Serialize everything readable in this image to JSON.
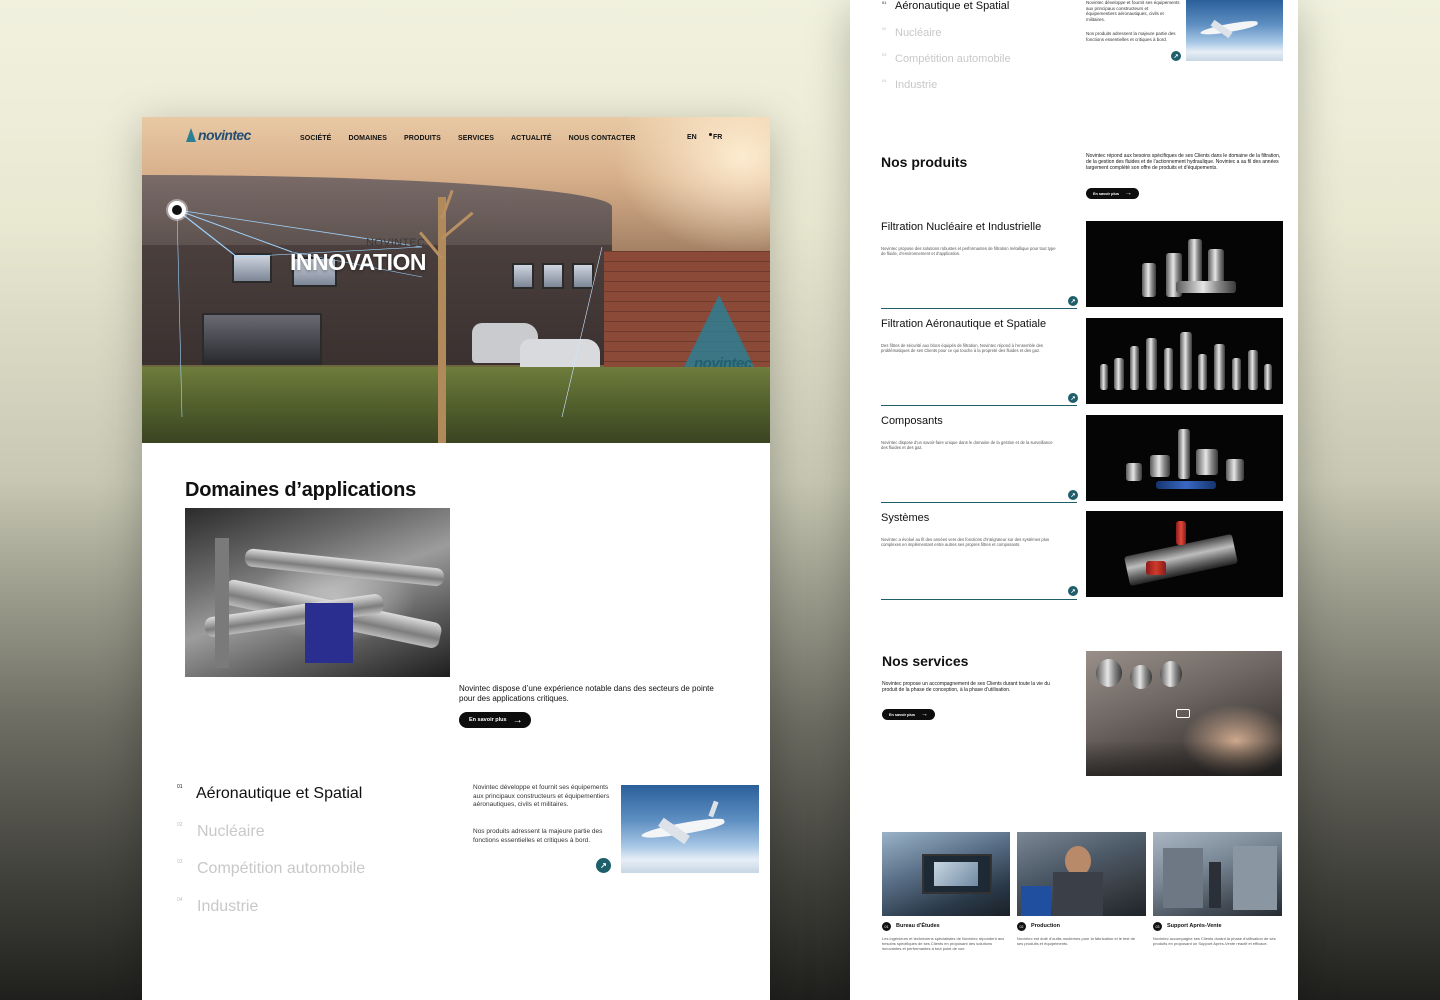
{
  "left_page": {
    "nav": {
      "logo": "novintec",
      "links": [
        "SOCIÉTÉ",
        "DOMAINES",
        "PRODUITS",
        "SERVICES",
        "ACTUALITÉ",
        "NOUS CONTACTER"
      ],
      "lang_en": "EN",
      "lang_fr": "FR"
    },
    "hero": {
      "brand_small": "NOVINTEC",
      "brand_big": "INNOVATION",
      "wall_sign": "novintec"
    },
    "domaines": {
      "title": "Domaines d’applications",
      "description": "Novintec dispose d’une expérience notable dans des secteurs de pointe pour des applications critiques.",
      "button": "En savoir plus"
    },
    "applications": [
      {
        "num": "01",
        "label": "Aéronautique et Spatial"
      },
      {
        "num": "02",
        "label": "Nucléaire"
      },
      {
        "num": "03",
        "label": "Compétition automobile"
      },
      {
        "num": "04",
        "label": "Industrie"
      }
    ],
    "app_desc_1": "Novintec développe et fournit ses équipements aux principaux constructeurs et équipementiers aéronautiques, civils et militaires.",
    "app_desc_2": "Nos produits adressent la majeure partie des fonctions essentielles et critiques à bord."
  },
  "right_page": {
    "applications": [
      {
        "num": "01",
        "label": "Aéronautique et Spatial"
      },
      {
        "num": "02",
        "label": "Nucléaire"
      },
      {
        "num": "03",
        "label": "Compétition automobile"
      },
      {
        "num": "04",
        "label": "Industrie"
      }
    ],
    "app_desc_1": "Novintec développe et fournit ses équipements aux principaux constructeurs et équipementiers aéronautiques, civils et militaires.",
    "app_desc_2": "Nos produits adressent la majeure partie des fonctions essentielles et critiques à bord.",
    "produits": {
      "title": "Nos produits",
      "intro": "Novintec répond aux besoins spécifiques de ses Clients dans le domaine de la filtration, de la gestion des fluides et de l’actionnement hydraulique. Novintec a au fil des années largement complété son offre de produits et d’équipements.",
      "button": "En savoir plus",
      "items": [
        {
          "title": "Filtration Nucléaire et Industrielle",
          "desc": "Novintec propose des solutions robustes et performantes de filtration métallique pour tout type de fluide, d’environnement et d’application."
        },
        {
          "title": "Filtration Aéronautique et Spatiale",
          "desc": "Des filtres de sécurité aux blocs équipés de filtration, Novintec répond à l’ensemble des problématiques de ses Clients pour ce qui touche à la propreté des fluides et des gaz."
        },
        {
          "title": "Composants",
          "desc": "Novintec dispose d’un savoir-faire unique dans le domaine de la gestion et de la surveillance des fluides et des gaz."
        },
        {
          "title": "Systèmes",
          "desc": "Novintec a évolué au fil des années vers des fonctions d’intégrateur sur des systèmes plus complexes en implémentant entre autres ses propres filtres et composants."
        }
      ]
    },
    "services": {
      "title": "Nos services",
      "intro": "Novintec propose un accompagnement de ses Clients durant toute la vie du produit de la phase de conception, à la phase d’utilisation.",
      "button": "En savoir plus",
      "cards": [
        {
          "num": "01",
          "title": "Bureau d’Études",
          "desc": "Les ingénieurs et techniciens spécialistes de Novintec répondent aux besoins spécifiques de ses Clients en proposant des solutions innovantes et performantes à tout point de vue."
        },
        {
          "num": "02",
          "title": "Production",
          "desc": "Novintec est doté d’outils modernes pour la fabrication et le test de ses produits et équipements."
        },
        {
          "num": "03",
          "title": "Support Après-Vente",
          "desc": "Novintec accompagne ses Clients durant la phase d’utilisation de ses produits en proposant un Support Après-Vente réactif et efficace."
        }
      ]
    }
  },
  "colors": {
    "accent_teal": "#1e5f6b",
    "dark_button": "#0d0d0d",
    "dim_text": "#c8c8c8"
  },
  "icons": [
    "arrow-right-icon",
    "diagonal-arrow-icon",
    "camera-icon",
    "logo-triangle-icon"
  ]
}
